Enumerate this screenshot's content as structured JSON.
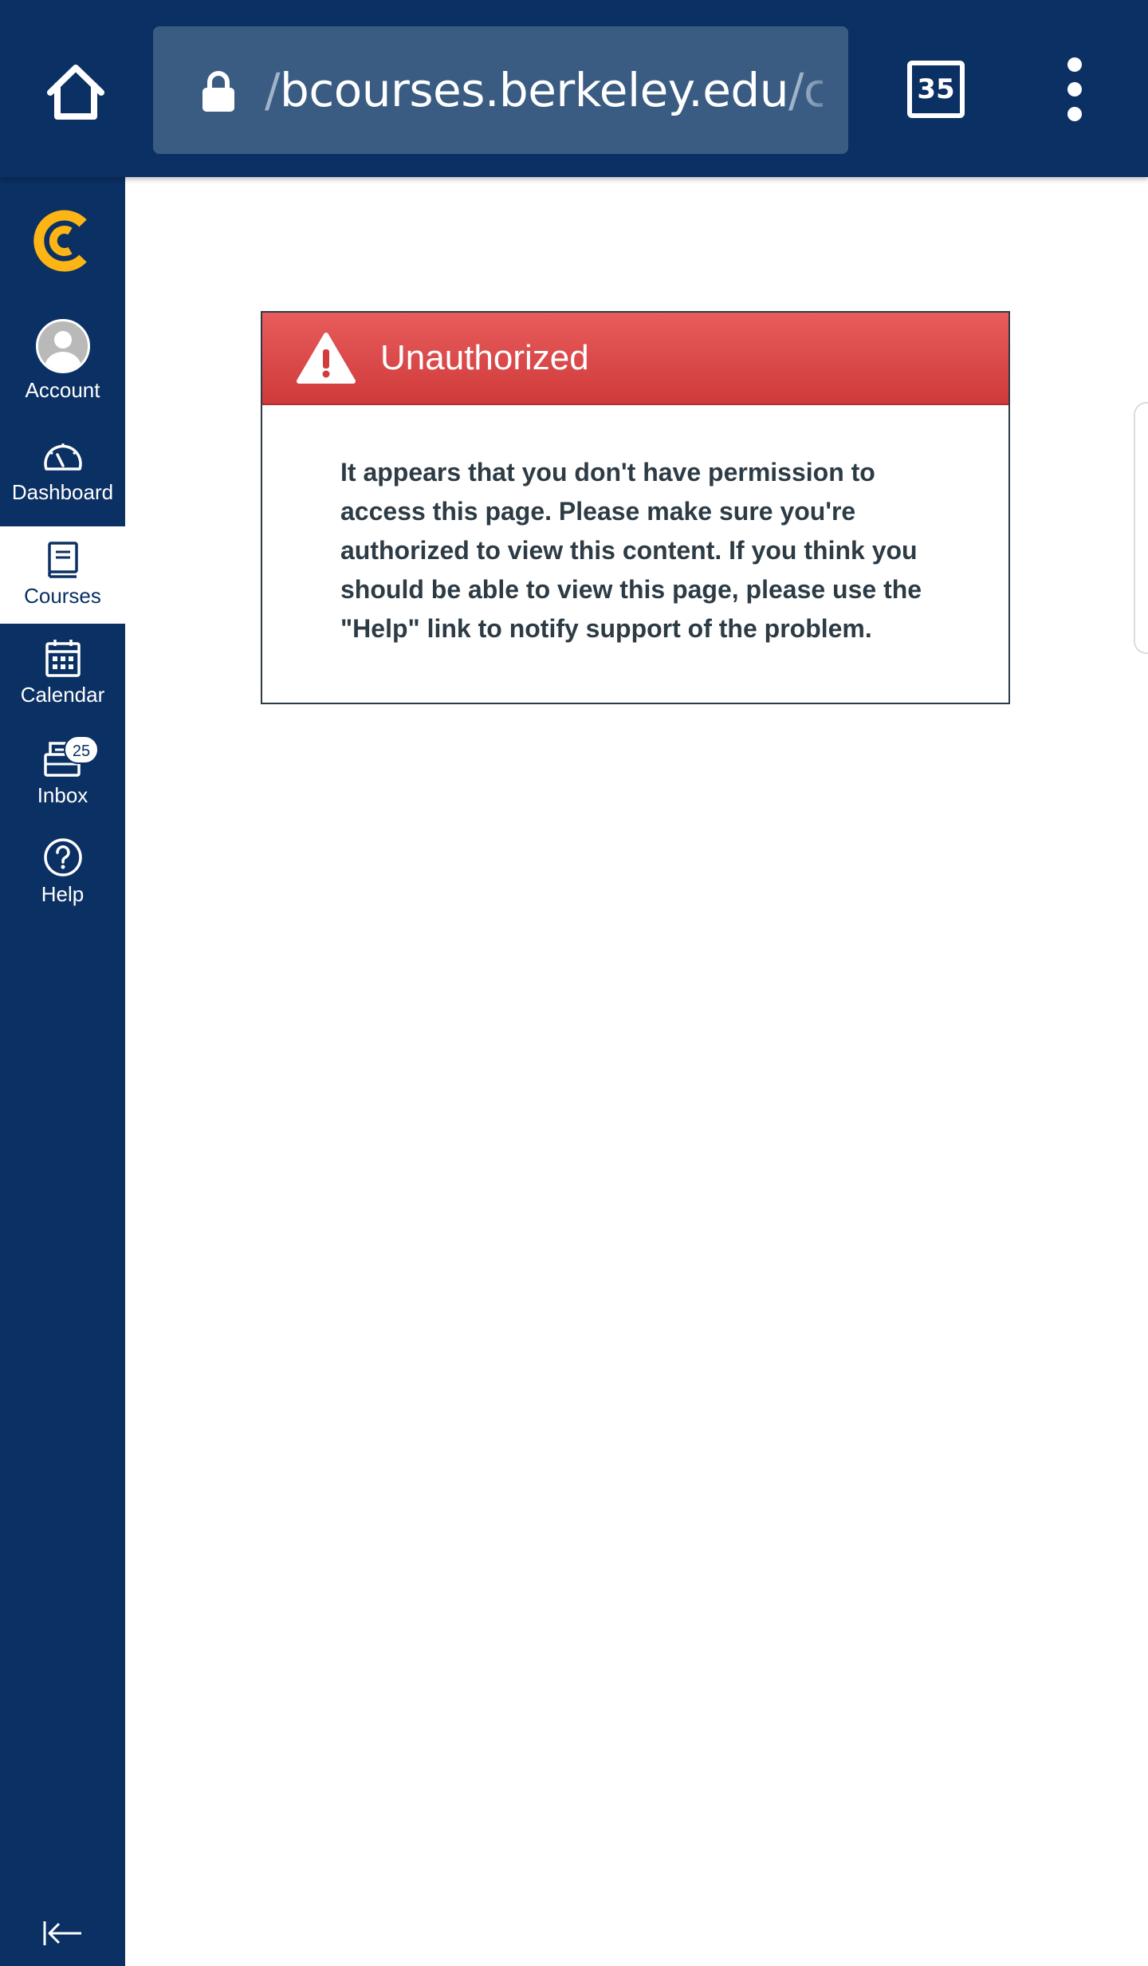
{
  "browser": {
    "url_prefix": "/",
    "url_main": "bcourses.berkeley.edu",
    "url_suffix": "/c",
    "tab_count": "35"
  },
  "nav": {
    "items": [
      {
        "label": "Account",
        "icon": "avatar"
      },
      {
        "label": "Dashboard",
        "icon": "dashboard-icon"
      },
      {
        "label": "Courses",
        "icon": "courses-icon",
        "active": true
      },
      {
        "label": "Calendar",
        "icon": "calendar-icon"
      },
      {
        "label": "Inbox",
        "icon": "inbox-icon",
        "badge": "25"
      },
      {
        "label": "Help",
        "icon": "help-icon"
      }
    ]
  },
  "error": {
    "title": "Unauthorized",
    "message": "It appears that you don't have permission to access this page. Please make sure you're authorized to view this content. If you think you should be able to view this page, please use the \"Help\" link to notify support of the problem."
  },
  "colors": {
    "nav_bg": "#0b3063",
    "logo": "#fdb515",
    "error_header": "#d64545",
    "text": "#2d3b45"
  }
}
